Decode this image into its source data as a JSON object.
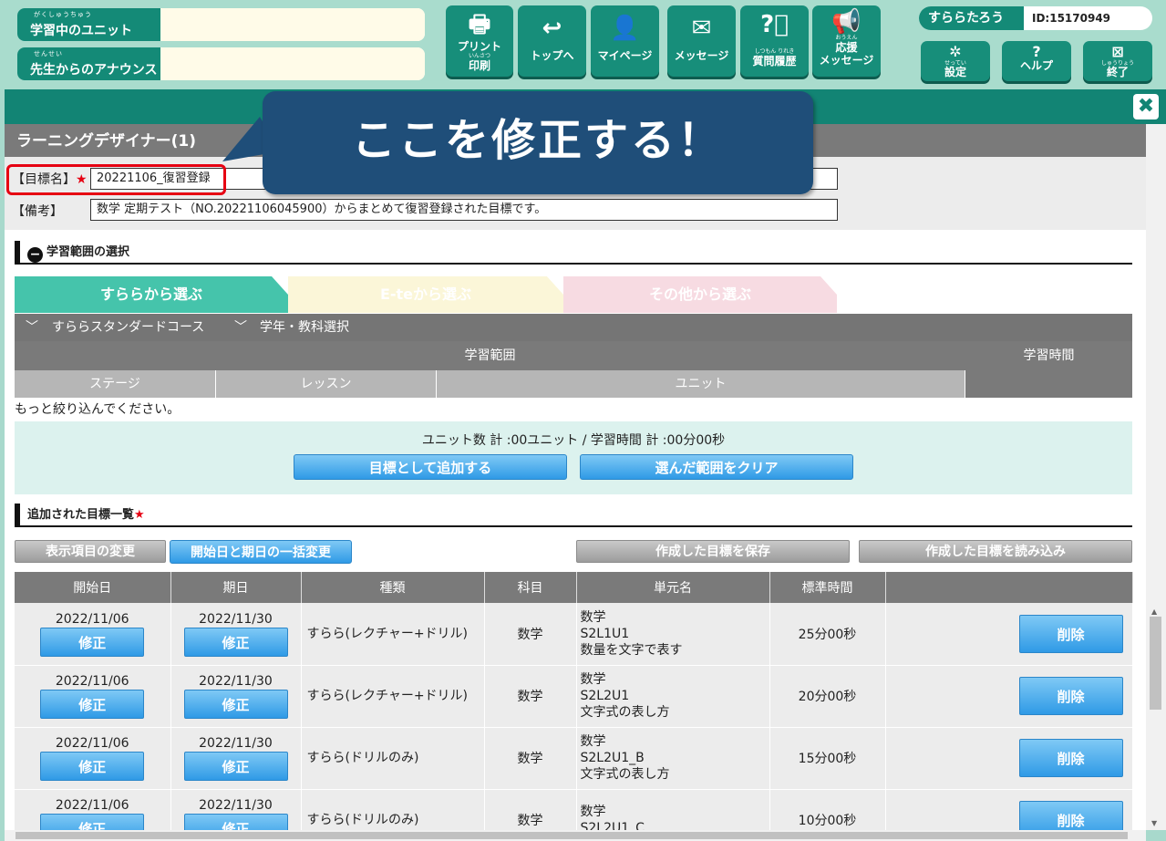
{
  "header": {
    "learning_unit": {
      "ruby": "がくしゅうちゅう",
      "label": "学習中のユニット"
    },
    "announcement": {
      "ruby": "せんせい",
      "label": "先生からのアナウンス"
    },
    "buttons": [
      {
        "icon": "printer-icon",
        "ruby": "いんさつ",
        "label1": "プリント",
        "label2": "印刷"
      },
      {
        "icon": "back-arrow-icon",
        "ruby": "",
        "label1": "",
        "label2": "トップへ"
      },
      {
        "icon": "person-icon",
        "ruby": "",
        "label1": "",
        "label2": "マイページ"
      },
      {
        "icon": "envelope-icon",
        "ruby": "",
        "label1": "",
        "label2": "メッセージ"
      },
      {
        "icon": "question-bubble-icon",
        "ruby": "しつもん りれき",
        "label1": "",
        "label2": "質問履歴"
      },
      {
        "icon": "megaphone-icon",
        "ruby": "おうえん",
        "label1": "応援",
        "label2": "メッセージ"
      }
    ],
    "user_name": "すららたろう",
    "user_id": "ID:15170949",
    "settings": {
      "ruby": "せってい",
      "label": "設定"
    },
    "help": {
      "ruby": "",
      "label": "ヘルプ"
    },
    "quit": {
      "ruby": "しゅうりょう",
      "label": "終了"
    }
  },
  "window": {
    "title": "ラーニングデザイナー(1)",
    "close": "✖"
  },
  "form": {
    "goal_label": "【目標名】",
    "goal_star": "★",
    "goal_value": "20221106_復習登録",
    "note_label": "【備考】",
    "note_value": "数学 定期テスト（NO.20221106045900）からまとめて復習登録された目標です。"
  },
  "callout": "ここを修正する！",
  "range_section": {
    "title": "学習範囲の選択",
    "tabs": [
      "すららから選ぶ",
      "E-teから選ぶ",
      "その他から選ぶ"
    ],
    "course": "すららスタンダードコース",
    "grade_subject": "学年・教科選択",
    "range_header": "学習範囲",
    "time_header": "学習時間",
    "columns": [
      "ステージ",
      "レッスン",
      "ユニット"
    ],
    "message": "もっと絞り込んでください。",
    "summary": "ユニット数 計 :00ユニット / 学習時間 計 :00分00秒",
    "add_button": "目標として追加する",
    "clear_button": "選んだ範囲をクリア"
  },
  "goals_section": {
    "title": "追加された目標一覧",
    "star": "★",
    "display_items_button": "表示項目の変更",
    "bulk_change_button": "開始日と期日の一括変更",
    "save_button": "作成した目標を保存",
    "load_button": "作成した目標を読み込み",
    "columns": [
      "開始日",
      "期日",
      "種類",
      "科目",
      "単元名",
      "標準時間",
      ""
    ],
    "fix_label": "修正",
    "delete_label": "削除",
    "rows": [
      {
        "start": "2022/11/06",
        "due": "2022/11/30",
        "kind": "すらら(レクチャー+ドリル)",
        "subject": "数学",
        "unit1": "数学",
        "unit2": "S2L1U1",
        "unit3": "数量を文字で表す",
        "time": "25分00秒"
      },
      {
        "start": "2022/11/06",
        "due": "2022/11/30",
        "kind": "すらら(レクチャー+ドリル)",
        "subject": "数学",
        "unit1": "数学",
        "unit2": "S2L2U1",
        "unit3": "文字式の表し方",
        "time": "20分00秒"
      },
      {
        "start": "2022/11/06",
        "due": "2022/11/30",
        "kind": "すらら(ドリルのみ)",
        "subject": "数学",
        "unit1": "数学",
        "unit2": "S2L2U1_B",
        "unit3": "文字式の表し方",
        "time": "15分00秒"
      },
      {
        "start": "2022/11/06",
        "due": "2022/11/30",
        "kind": "すらら(ドリルのみ)",
        "subject": "数学",
        "unit1": "数学",
        "unit2": "S2L2U1_C",
        "unit3": "",
        "time": "10分00秒"
      }
    ]
  },
  "colors": {
    "accent": "#148a77",
    "highlight": "#e60012",
    "callout": "#1f4e79",
    "button_blue": "#2f9ae6"
  }
}
